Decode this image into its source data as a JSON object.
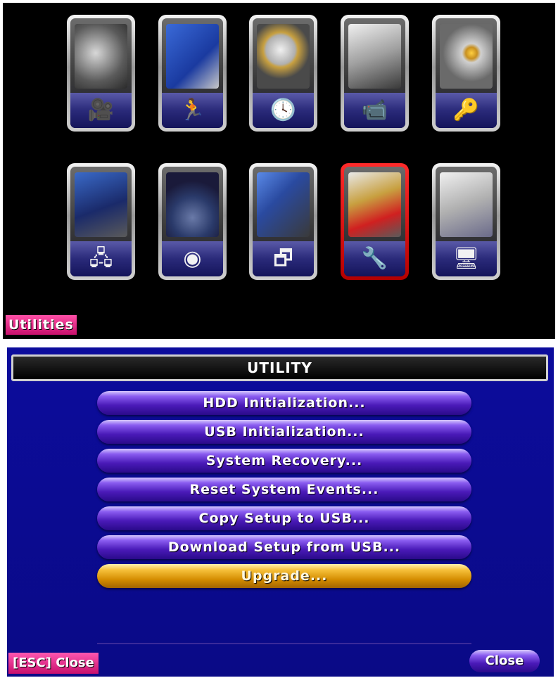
{
  "main_menu": {
    "tiles": [
      {
        "name": "tile-camera",
        "icon": "camera-reel-icon",
        "glyph": "🎥",
        "selected": false
      },
      {
        "name": "tile-motion",
        "icon": "motion-person-icon",
        "glyph": "🏃",
        "selected": false
      },
      {
        "name": "tile-schedule",
        "icon": "clock-list-icon",
        "glyph": "🕓",
        "selected": false
      },
      {
        "name": "tile-record",
        "icon": "video-camera-icon",
        "glyph": "📹",
        "selected": false
      },
      {
        "name": "tile-security",
        "icon": "key-icon",
        "glyph": "🔑",
        "selected": false
      },
      {
        "name": "tile-network",
        "icon": "network-icon",
        "glyph": "🖧",
        "selected": false
      },
      {
        "name": "tile-ptz",
        "icon": "dome-camera-icon",
        "glyph": "◉",
        "selected": false
      },
      {
        "name": "tile-display",
        "icon": "windows-icon",
        "glyph": "🗗",
        "selected": false
      },
      {
        "name": "tile-utilities",
        "icon": "wrench-icon",
        "glyph": "🔧",
        "selected": true
      },
      {
        "name": "tile-system",
        "icon": "monitor-icon",
        "glyph": "🖥",
        "selected": false
      }
    ],
    "status_label": "Utilities"
  },
  "utility_dialog": {
    "title": "UTILITY",
    "items": [
      {
        "label": "HDD Initialization..."
      },
      {
        "label": "USB Initialization..."
      },
      {
        "label": "System Recovery..."
      },
      {
        "label": "Reset System Events..."
      },
      {
        "label": "Copy Setup to USB..."
      },
      {
        "label": "Download Setup from USB..."
      },
      {
        "label": "Upgrade..."
      }
    ],
    "selected_item": "Upgrade...",
    "esc_hint": "[ESC] Close",
    "close_label": "Close"
  },
  "colors": {
    "dialog_background": "#0a0a8c",
    "button_purple": "#4a1ab8",
    "button_gold": "#e0a010",
    "selected_tile_border": "#e00000",
    "badge_pink": "#e0288a"
  }
}
